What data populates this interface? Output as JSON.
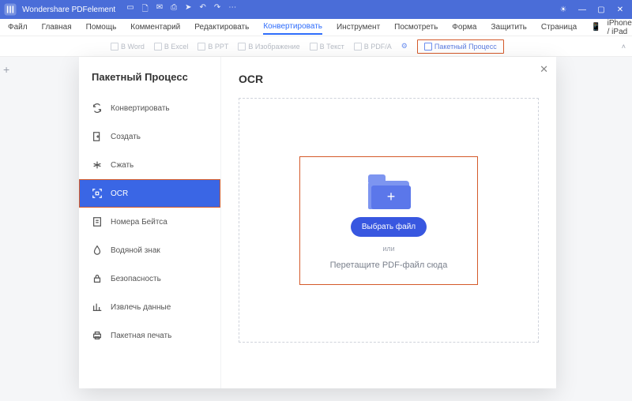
{
  "titlebar": {
    "app_name": "Wondershare PDFelement"
  },
  "menubar": {
    "items": [
      "Файл",
      "Главная",
      "Помощь",
      "Комментарий",
      "Редактировать",
      "Конвертировать",
      "Инструмент",
      "Посмотреть",
      "Форма",
      "Защитить",
      "Страница"
    ],
    "active_index": 5,
    "device_label": "iPhone / iPad"
  },
  "toolbar": {
    "items": [
      "В Word",
      "В Excel",
      "В PPT",
      "В Изображение",
      "В Текст",
      "В PDF/A"
    ],
    "batch_label": "Пакетный Процесс"
  },
  "modal": {
    "title": "Пакетный Процесс",
    "pane_title": "OCR",
    "sidebar": [
      {
        "icon": "convert",
        "label": "Конвертировать"
      },
      {
        "icon": "create",
        "label": "Создать"
      },
      {
        "icon": "compress",
        "label": "Сжать"
      },
      {
        "icon": "ocr",
        "label": "OCR"
      },
      {
        "icon": "bates",
        "label": "Номера Бейтса"
      },
      {
        "icon": "watermark",
        "label": "Водяной знак"
      },
      {
        "icon": "security",
        "label": "Безопасность"
      },
      {
        "icon": "extract",
        "label": "Извлечь данные"
      },
      {
        "icon": "print",
        "label": "Пакетная печать"
      }
    ],
    "active_sidebar_index": 3,
    "dropzone": {
      "choose_button": "Выбрать файл",
      "or_text": "или",
      "drag_text": "Перетащите PDF-файл сюда"
    }
  }
}
